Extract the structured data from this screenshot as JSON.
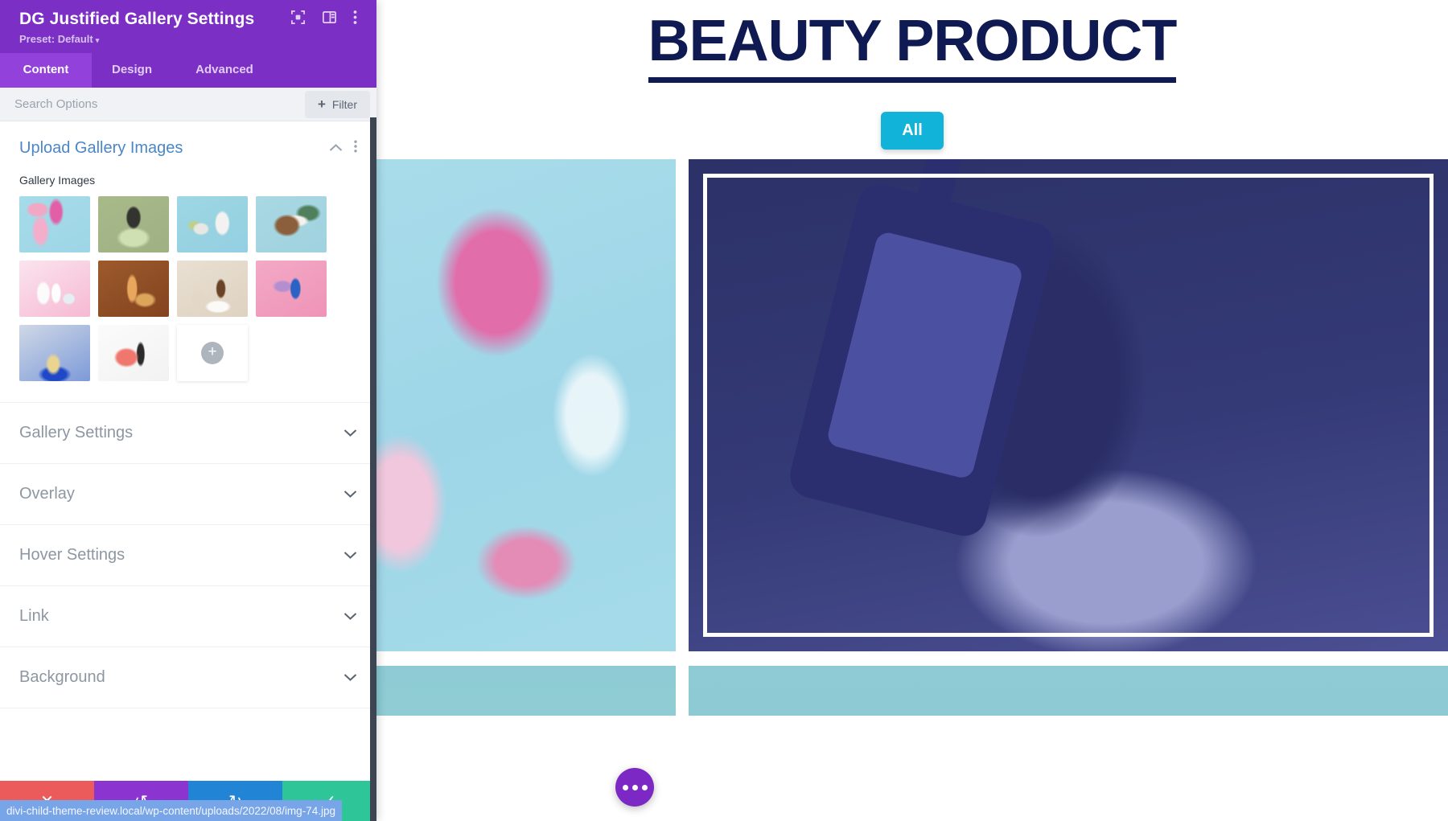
{
  "panel": {
    "title": "DG Justified Gallery Settings",
    "preset": "Preset: Default",
    "preset_caret": "▾",
    "header_icons": [
      {
        "name": "focus-target-icon"
      },
      {
        "name": "layout-panel-icon"
      },
      {
        "name": "kebab-menu-icon"
      }
    ],
    "tabs": [
      {
        "label": "Content",
        "active": true
      },
      {
        "label": "Design",
        "active": false
      },
      {
        "label": "Advanced",
        "active": false
      }
    ],
    "search": {
      "placeholder": "Search Options",
      "value": ""
    },
    "filter_button": {
      "label": "Filter",
      "plus": "+"
    },
    "open_section": {
      "title": "Upload Gallery Images",
      "collapse_icon": "⌃",
      "more_icon": "⋮",
      "field_label": "Gallery Images",
      "add_tile_glyph": "+",
      "thumbnails": [
        {
          "name": "pink-bottles-blue-bg"
        },
        {
          "name": "black-pump-bottle-green-bg"
        },
        {
          "name": "white-jar-bottle-blue-bg"
        },
        {
          "name": "coconut-cream-eucalyptus"
        },
        {
          "name": "white-bottles-pink-bg"
        },
        {
          "name": "amber-serum-brown-bg"
        },
        {
          "name": "reed-diffuser-beige-bg"
        },
        {
          "name": "blue-nail-polish-pink-bg"
        },
        {
          "name": "perfume-bottle-blue-bg"
        },
        {
          "name": "lipgloss-swatch-white-bg"
        }
      ]
    },
    "collapsed_sections": [
      {
        "title": "Gallery Settings",
        "chevron": "⌄"
      },
      {
        "title": "Overlay",
        "chevron": "⌄"
      },
      {
        "title": "Hover Settings",
        "chevron": "⌄"
      },
      {
        "title": "Link",
        "chevron": "⌄"
      },
      {
        "title": "Background",
        "chevron": "⌄"
      }
    ],
    "actions": [
      {
        "name": "discard-button",
        "glyph": "✕",
        "color": "#eb5b5b"
      },
      {
        "name": "undo-button",
        "glyph": "↺",
        "color": "#8b34cf"
      },
      {
        "name": "redo-button",
        "glyph": "↻",
        "color": "#2184d4"
      },
      {
        "name": "save-button",
        "glyph": "✓",
        "color": "#2ec598"
      }
    ]
  },
  "preview": {
    "heading": "BEAUTY PRODUCT",
    "filter_all_label": "All",
    "fab": {
      "name": "options-fab",
      "dots": 3
    },
    "gallery": [
      {
        "name": "gallery-image-pink-spa-set",
        "state": "normal"
      },
      {
        "name": "gallery-image-pump-bottle",
        "state": "hover-overlay"
      },
      {
        "name": "gallery-image-teal-left",
        "state": "normal"
      },
      {
        "name": "gallery-image-teal-right",
        "state": "normal"
      }
    ]
  },
  "statusbar": {
    "url": "divi-child-theme-review.local/wp-content/uploads/2022/08/img-74.jpg"
  },
  "colors": {
    "brand_purple": "#7b2fc4",
    "tab_active": "#9242da",
    "heading_navy": "#101a52",
    "filter_cyan": "#12b3d8",
    "overlay_navy": "#2c3168",
    "status_blue": "#78a5e8"
  }
}
